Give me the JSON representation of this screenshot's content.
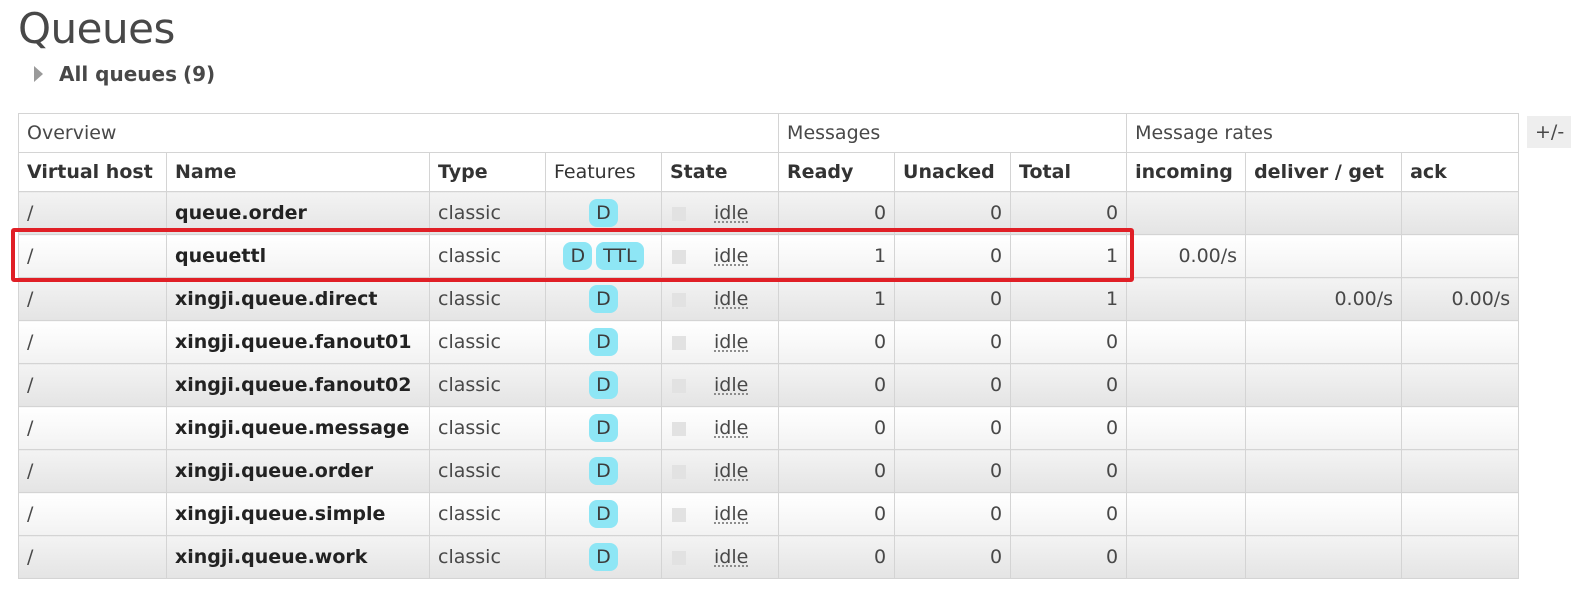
{
  "page": {
    "title": "Queues"
  },
  "section": {
    "label": "All queues",
    "count": "(9)"
  },
  "table": {
    "group_headers": [
      "Overview",
      "Messages",
      "Message rates"
    ],
    "column_toggle": "+/-",
    "columns": [
      "Virtual host",
      "Name",
      "Type",
      "Features",
      "State",
      "Ready",
      "Unacked",
      "Total",
      "incoming",
      "deliver / get",
      "ack"
    ],
    "rows": [
      {
        "vhost": "/",
        "name": "queue.order",
        "type": "classic",
        "features": [
          "D"
        ],
        "state": "idle",
        "ready": "0",
        "unacked": "0",
        "total": "0",
        "incoming": "",
        "deliver_get": "",
        "ack": ""
      },
      {
        "vhost": "/",
        "name": "queuettl",
        "type": "classic",
        "features": [
          "D",
          "TTL"
        ],
        "state": "idle",
        "ready": "1",
        "unacked": "0",
        "total": "1",
        "incoming": "0.00/s",
        "deliver_get": "",
        "ack": ""
      },
      {
        "vhost": "/",
        "name": "xingji.queue.direct",
        "type": "classic",
        "features": [
          "D"
        ],
        "state": "idle",
        "ready": "1",
        "unacked": "0",
        "total": "1",
        "incoming": "",
        "deliver_get": "0.00/s",
        "ack": "0.00/s"
      },
      {
        "vhost": "/",
        "name": "xingji.queue.fanout01",
        "type": "classic",
        "features": [
          "D"
        ],
        "state": "idle",
        "ready": "0",
        "unacked": "0",
        "total": "0",
        "incoming": "",
        "deliver_get": "",
        "ack": ""
      },
      {
        "vhost": "/",
        "name": "xingji.queue.fanout02",
        "type": "classic",
        "features": [
          "D"
        ],
        "state": "idle",
        "ready": "0",
        "unacked": "0",
        "total": "0",
        "incoming": "",
        "deliver_get": "",
        "ack": ""
      },
      {
        "vhost": "/",
        "name": "xingji.queue.message",
        "type": "classic",
        "features": [
          "D"
        ],
        "state": "idle",
        "ready": "0",
        "unacked": "0",
        "total": "0",
        "incoming": "",
        "deliver_get": "",
        "ack": ""
      },
      {
        "vhost": "/",
        "name": "xingji.queue.order",
        "type": "classic",
        "features": [
          "D"
        ],
        "state": "idle",
        "ready": "0",
        "unacked": "0",
        "total": "0",
        "incoming": "",
        "deliver_get": "",
        "ack": ""
      },
      {
        "vhost": "/",
        "name": "xingji.queue.simple",
        "type": "classic",
        "features": [
          "D"
        ],
        "state": "idle",
        "ready": "0",
        "unacked": "0",
        "total": "0",
        "incoming": "",
        "deliver_get": "",
        "ack": ""
      },
      {
        "vhost": "/",
        "name": "xingji.queue.work",
        "type": "classic",
        "features": [
          "D"
        ],
        "state": "idle",
        "ready": "0",
        "unacked": "0",
        "total": "0",
        "incoming": "",
        "deliver_get": "",
        "ack": ""
      }
    ]
  },
  "colors": {
    "badge": "#8ee6f5",
    "highlight": "#e01f26",
    "text": "#484848"
  }
}
